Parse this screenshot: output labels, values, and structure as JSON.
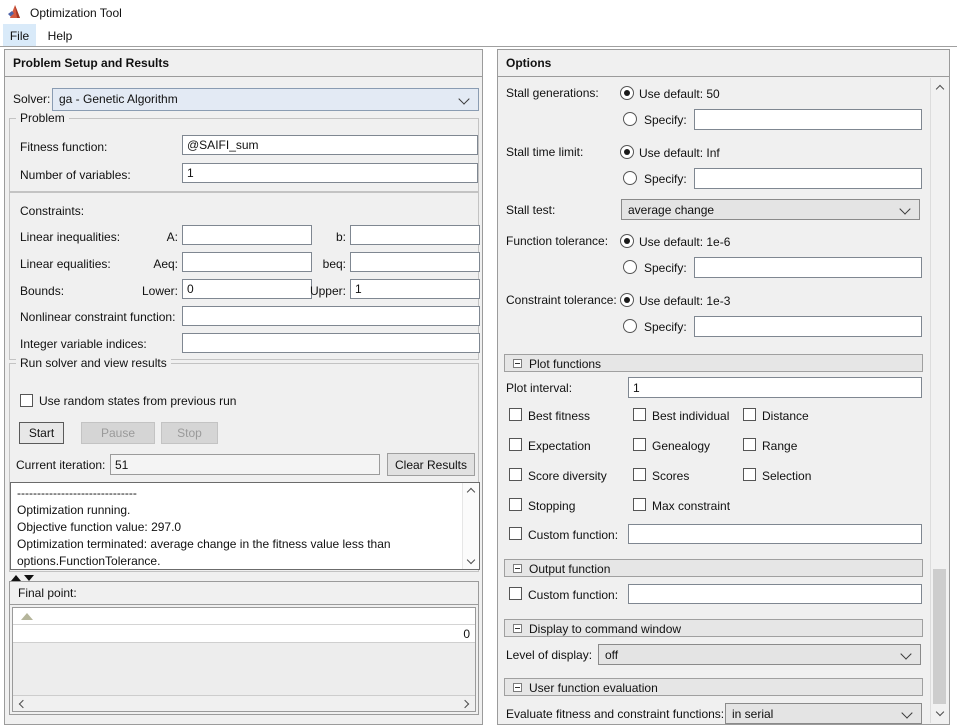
{
  "window": {
    "title": "Optimization Tool"
  },
  "menu": {
    "items": [
      {
        "label": "File"
      },
      {
        "label": "Help"
      }
    ]
  },
  "colors": {
    "menu_highlight": "#d9eaf9",
    "solver_field_bg": "#e3eaf4",
    "logo_red": "#d45a41",
    "logo_dark_red": "#a33723",
    "logo_blue": "#4f63a8",
    "panel_bg": "#f0f0f0"
  },
  "left": {
    "header": "Problem Setup and Results",
    "solver": {
      "label": "Solver:",
      "value": "ga - Genetic Algorithm"
    },
    "problem": {
      "title": "Problem",
      "fitness_label": "Fitness function:",
      "fitness_value": "@SAIFI_sum",
      "nvars_label": "Number of variables:",
      "nvars_value": "1"
    },
    "constraints": {
      "title": "Constraints:",
      "rows": [
        {
          "label": "Linear inequalities:",
          "f1": "A:",
          "v1": "",
          "f2": "b:",
          "v2": ""
        },
        {
          "label": "Linear equalities:",
          "f1": "Aeq:",
          "v1": "",
          "f2": "beq:",
          "v2": ""
        },
        {
          "label": "Bounds:",
          "f1": "Lower:",
          "v1": "0",
          "f2": "Upper:",
          "v2": "1"
        }
      ],
      "nonlinear_label": "Nonlinear constraint function:",
      "nonlinear_value": "",
      "integer_label": "Integer variable indices:",
      "integer_value": ""
    },
    "run": {
      "title": "Run solver and view results",
      "random_states_label": "Use random states from previous run",
      "start_label": "Start",
      "pause_label": "Pause",
      "stop_label": "Stop",
      "iteration_label": "Current iteration:",
      "iteration_value": "51",
      "clear_label": "Clear Results",
      "log_lines": [
        "------------------------------",
        "Optimization running.",
        "Objective function value: 297.0",
        "Optimization terminated: average change in the fitness value less than",
        "options.FunctionTolerance."
      ]
    },
    "final_point": {
      "title": "Final point:",
      "value": "0"
    }
  },
  "right": {
    "header": "Options",
    "stall_generations": {
      "label": "Stall generations:",
      "default_label": "Use default: 50",
      "specify_label": "Specify:",
      "specify_value": ""
    },
    "stall_time": {
      "label": "Stall time limit:",
      "default_label": "Use default: Inf",
      "specify_label": "Specify:",
      "specify_value": ""
    },
    "stall_test": {
      "label": "Stall test:",
      "value": "average change"
    },
    "function_tolerance": {
      "label": "Function tolerance:",
      "default_label": "Use default: 1e-6",
      "specify_label": "Specify:",
      "specify_value": ""
    },
    "constraint_tolerance": {
      "label": "Constraint tolerance:",
      "default_label": "Use default: 1e-3",
      "specify_label": "Specify:",
      "specify_value": ""
    },
    "plot": {
      "title": "Plot functions",
      "interval_label": "Plot interval:",
      "interval_value": "1",
      "checkboxes": [
        "Best fitness",
        "Best individual",
        "Distance",
        "Expectation",
        "Genealogy",
        "Range",
        "Score diversity",
        "Scores",
        "Selection",
        "Stopping",
        "Max constraint"
      ],
      "custom_label": "Custom function:",
      "custom_value": ""
    },
    "output_function": {
      "title": "Output function",
      "custom_label": "Custom function:",
      "custom_value": ""
    },
    "display": {
      "title": "Display to command window",
      "label": "Level of display:",
      "value": "off"
    },
    "user_eval": {
      "title": "User function evaluation",
      "label": "Evaluate fitness and constraint functions:",
      "value": "in serial"
    }
  }
}
